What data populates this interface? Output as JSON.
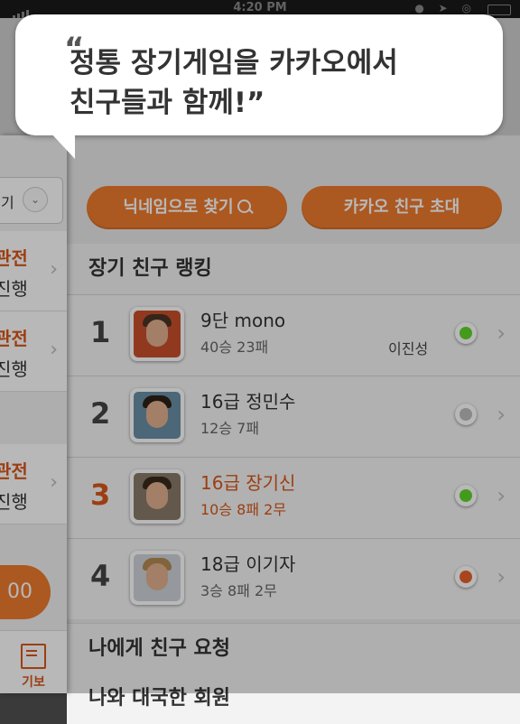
{
  "status_bar": {
    "time": "4:20 PM"
  },
  "tooltip": {
    "open_quote": "“",
    "line1": "정통 장기게임을 카카오에서",
    "line2": "친구들과 함께!”"
  },
  "left_panel": {
    "select_text": "기",
    "cells": [
      {
        "status": "관전",
        "state": "진행"
      },
      {
        "status": "관전",
        "state": "진행"
      },
      {
        "status": "관전",
        "state": "진행"
      }
    ],
    "pill_text": "00",
    "gibo_label": "기보"
  },
  "buttons": {
    "search_nickname": "닉네임으로 찾기",
    "invite_kakao": "카카오 친구 초대"
  },
  "sections": {
    "ranking_title": "장기 친구 랭킹",
    "requests_title": "나에게 친구 요청",
    "played_title": "나와 대국한 회원"
  },
  "ranking": [
    {
      "rank": "1",
      "name": "9단 mono",
      "record": "40승 23패",
      "kakao_name": "이진성",
      "status_color": "#5fd629"
    },
    {
      "rank": "2",
      "name": "16급 정민수",
      "record": "12승 7패",
      "kakao_name": "",
      "status_color": "#bdbdbd"
    },
    {
      "rank": "3",
      "name": "16급 장기신",
      "record": "10승 8패 2무",
      "kakao_name": "",
      "status_color": "#5fd629"
    },
    {
      "rank": "4",
      "name": "18급 이기자",
      "record": "3승 8패 2무",
      "kakao_name": "",
      "status_color": "#e8622a"
    }
  ],
  "colors": {
    "accent": "#ef7b2f",
    "highlight_text": "#d9561b"
  }
}
